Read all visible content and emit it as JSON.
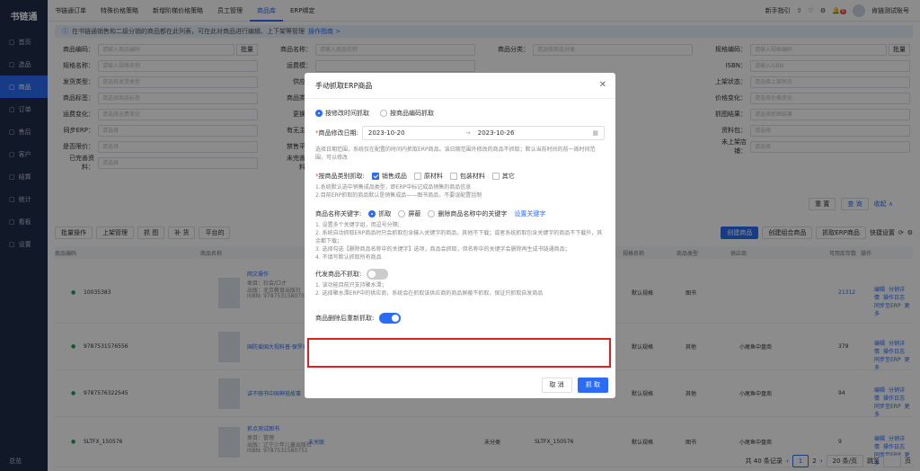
{
  "sidebar": {
    "logo": "书链通",
    "items": [
      "首页",
      "选品",
      "商品",
      "订单",
      "售后",
      "客户",
      "结算",
      "统计",
      "看板",
      "设置"
    ],
    "bottom": "总览"
  },
  "topnav": [
    "书链通订单",
    "特殊价格策略",
    "新增阶梯价格策略",
    "员工管理",
    "商品库",
    "ERP绑定"
  ],
  "topright": {
    "guide": "新手指引",
    "badge": "6",
    "user": "肯链测试账号"
  },
  "notice": {
    "text": "在书链通销售和二级分销的商品都在此列表，可在此对商品进行编辑、上下架等管理",
    "link": "操作指南 >"
  },
  "filters": [
    [
      "商品编码：",
      "请输入商品编码",
      "商品名称：",
      "请输入商品名称",
      "商品分类：",
      "请选择商品分类",
      "规格编码：",
      "请输入规格编码"
    ],
    [
      "规格名称：",
      "请输入规格名称",
      "运费模：",
      "",
      "",
      "",
      "ISBN：",
      "请输入ISBN"
    ],
    [
      "发货类型：",
      "请选择发货类型",
      "供应：",
      "",
      "",
      "",
      "上架状态：",
      "请选择上架状态"
    ],
    [
      "商品标签：",
      "请选择商品标签",
      "商品类：",
      "",
      "",
      "",
      "价格变化：",
      "请选择价格变化"
    ],
    [
      "运费变化：",
      "请选择运费变化",
      "更换：",
      "",
      "",
      "",
      "抓图结果：",
      "请选择抓图结果"
    ],
    [
      "同步ERP：",
      "请选择",
      "有无主：",
      "",
      "",
      "",
      "资料包：",
      "请选择"
    ],
    [
      "是否限价：",
      "请选择",
      "禁售平：",
      "",
      "",
      "",
      "未上架店铺：",
      "请选择"
    ],
    [
      "已完善资料：",
      "请选择",
      "未完善资料：",
      "",
      "",
      "",
      "",
      ""
    ]
  ],
  "filter_btns": {
    "batch": "批量",
    "reset": "重 置",
    "search": "查 询",
    "collapse": "收起 ∧"
  },
  "toolbar": {
    "batch_ops": "批量操作",
    "shelf": "上架管理",
    "grab": "抓 图",
    "fill": "补 货",
    "platform": "平台的",
    "create_product": "创建商品",
    "create_combo": "创建组合商品",
    "erp_grab": "抓取ERP商品",
    "quick_set": "快捷设置"
  },
  "table": {
    "headers": [
      "商品编码",
      "商品名称",
      "规格名称",
      "商品类型",
      "供应商",
      "可用库存数",
      "操作"
    ],
    "rows": [
      {
        "code": "10035383",
        "name": "网文操作",
        "sub": "类目：社会/口才",
        "pub": "出版：北京教育出版社",
        "isbn": "ISBN: 9787531580751",
        "spec": "默认规格",
        "type": "图书",
        "supplier": "",
        "stock": "21312"
      },
      {
        "code": "9787531576556",
        "name": "国防爱国大视科普·保罗再见...",
        "spec": "默认规格",
        "type": "其他",
        "supplier": "小尾鱼中盘商",
        "stock": "379"
      },
      {
        "code": "9787576322545",
        "name": "讲不够书中国神祇故事",
        "spec": "默认规格",
        "type": "其他",
        "supplier": "小尾鱼中盘商",
        "stock": "94"
      },
      {
        "code": "SLTFX_150576",
        "name": "抓点测试图书",
        "sub": "类目：管理",
        "pub": "出版：辽宁少年儿童出版社",
        "isbn": "ISBN: 9787531580751",
        "rel": "未关联",
        "cat": "未分类",
        "spec_code": "SLTFX_150576",
        "spec": "默认规格",
        "type": "图书",
        "supplier": "小尾鱼中盘商",
        "stock": "9"
      }
    ],
    "ops": {
      "edit": "编辑",
      "dist": "分销详情",
      "log": "操作日志",
      "sync": "同步至ERP",
      "more": "更多"
    }
  },
  "pager": {
    "total": "共 40 条记录",
    "page": "1",
    "next_page": "2",
    "size": "20 条/页",
    "jump": "跳至",
    "page_unit": "页"
  },
  "modal": {
    "title": "手动抓取ERP商品",
    "mode_options": [
      "按修改时间抓取",
      "按商品编码抓取"
    ],
    "date_label": "商品修改日期:",
    "date_start": "2023-10-20",
    "date_end": "2023-10-26",
    "date_hint": "选择日期范围，系统仅在配置的时间内抓取ERP商品。该日期范围外修改的商品不抓取；默认当前时间的前一周时间范围，可以修改",
    "cat_label": "按商品类别抓取:",
    "cats": [
      "销售成品",
      "原材料",
      "包装材料",
      "其它"
    ],
    "cat_hint1": "1.系统默认选中销售成品类型，即ERP中标记成品销售的商品信息",
    "cat_hint2": "2.目前ERP抓取的商品默认是销售成品——图书商品，不要误配置括制",
    "kw_label": "商品名称关键字:",
    "kw_options": [
      "抓取",
      "屏蔽",
      "删除商品名称中的关键字"
    ],
    "kw_link": "设置关键字",
    "kw_hints": [
      "1. 设置多个关键字组，用逗号分隔;",
      "2. 系统自动抓取ERP商品时只会抓取包含输入关键字的商品，其他不下载；或者系统抓取包含关键字的商品不下载外，其余都下载；",
      "3. 选择勾选【删除商品名称中的关键字】选项，商品会抓取，但名称中的关键字会删除再生成书链通商品；",
      "4. 不填写默认抓取所有商品"
    ],
    "agent_label": "代发商品不抓取:",
    "agent_hint1": "1. 该功能目前只支持聚水潭；",
    "agent_hint2": "2. 选择聚水潭ERP中的供应商，系统会在抓取该供应商的商品屏蔽不抓取，保证只抓取自发商品",
    "refetch_label": "商品删除后重新抓取:",
    "cancel": "取 消",
    "confirm": "抓 取"
  }
}
